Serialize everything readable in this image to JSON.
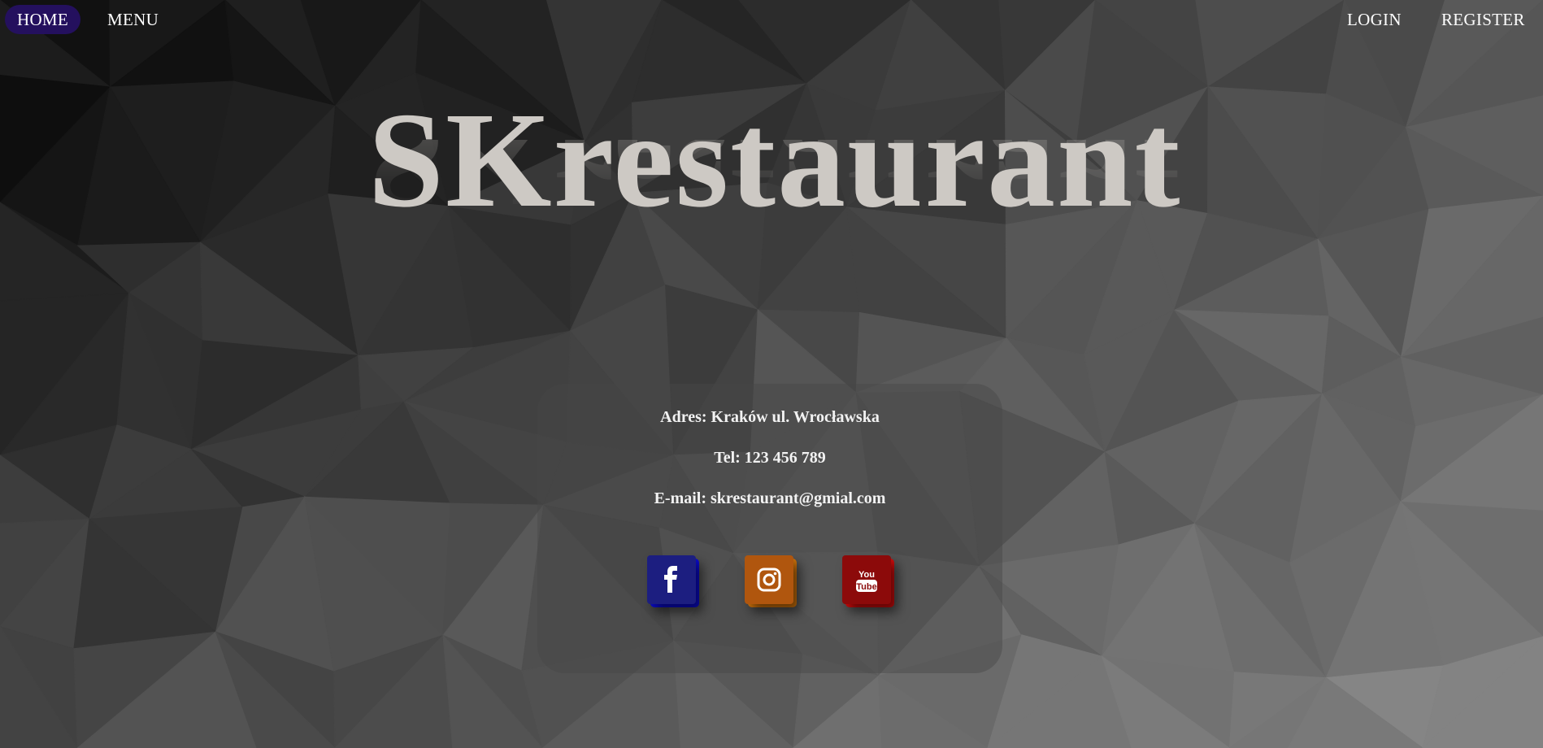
{
  "nav": {
    "home": "HOME",
    "menu": "MENU",
    "login": "LOGIN",
    "register": "REGISTER"
  },
  "hero": {
    "title": "SKrestaurant"
  },
  "contact": {
    "address": "Adres: Kraków ul. Wrocławska",
    "tel": "Tel: 123 456 789",
    "email": "E-mail: skrestaurant@gmial.com"
  },
  "social": [
    {
      "name": "facebook-icon",
      "color": "#1c1e80",
      "accent": "#0b0bd8"
    },
    {
      "name": "instagram-icon",
      "color": "#b0560e",
      "accent": "#d8770a"
    },
    {
      "name": "youtube-icon",
      "color": "#8c0a0a",
      "accent": "#d80c0c"
    }
  ],
  "colors": {
    "nav_active": "#24105e",
    "title": "#cdc9c4"
  }
}
